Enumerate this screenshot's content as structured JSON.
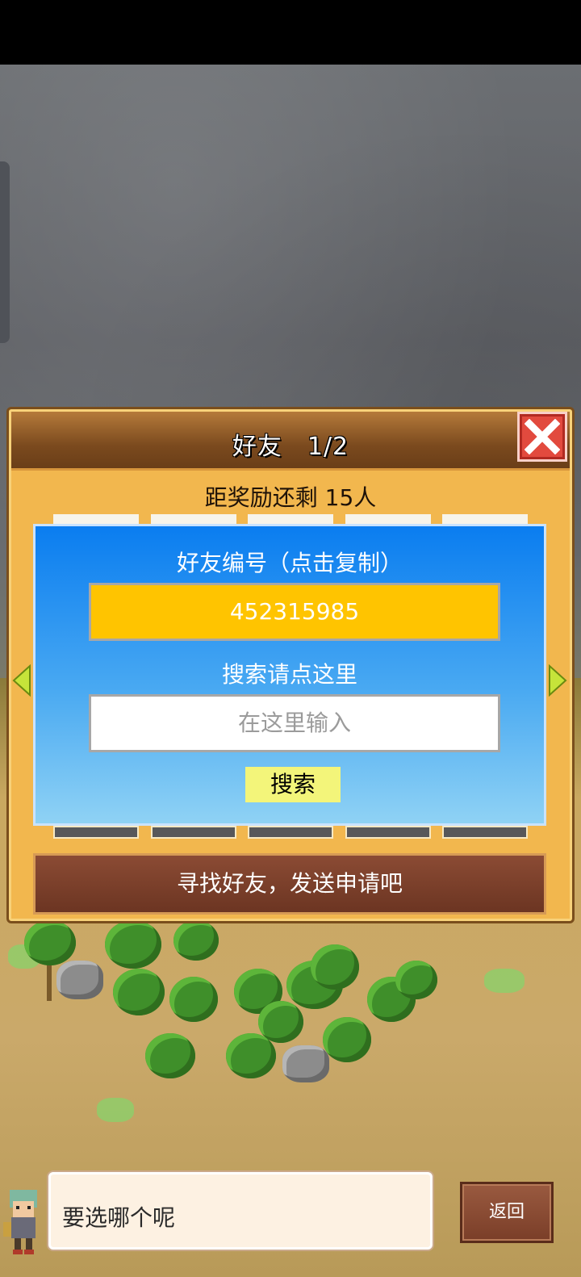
{
  "panel": {
    "title": "好友　1/2",
    "reward_text": "距奖励还剩 15人"
  },
  "friend_box": {
    "id_label": "好友编号（点击复制）",
    "id_value": "452315985",
    "search_label": "搜索请点这里",
    "search_placeholder": "在这里输入",
    "search_button": "搜索"
  },
  "send_bar_text": "寻找好友，发送申请吧",
  "dialog_text": "要选哪个呢",
  "back_button": "返回",
  "colors": {
    "panel": "#f2b74e",
    "header": "#7b4a1e",
    "blue_box_top": "#0a7df0",
    "id_bar": "#ffc400",
    "search_button": "#f3f57a",
    "close": "#e24a3e"
  }
}
